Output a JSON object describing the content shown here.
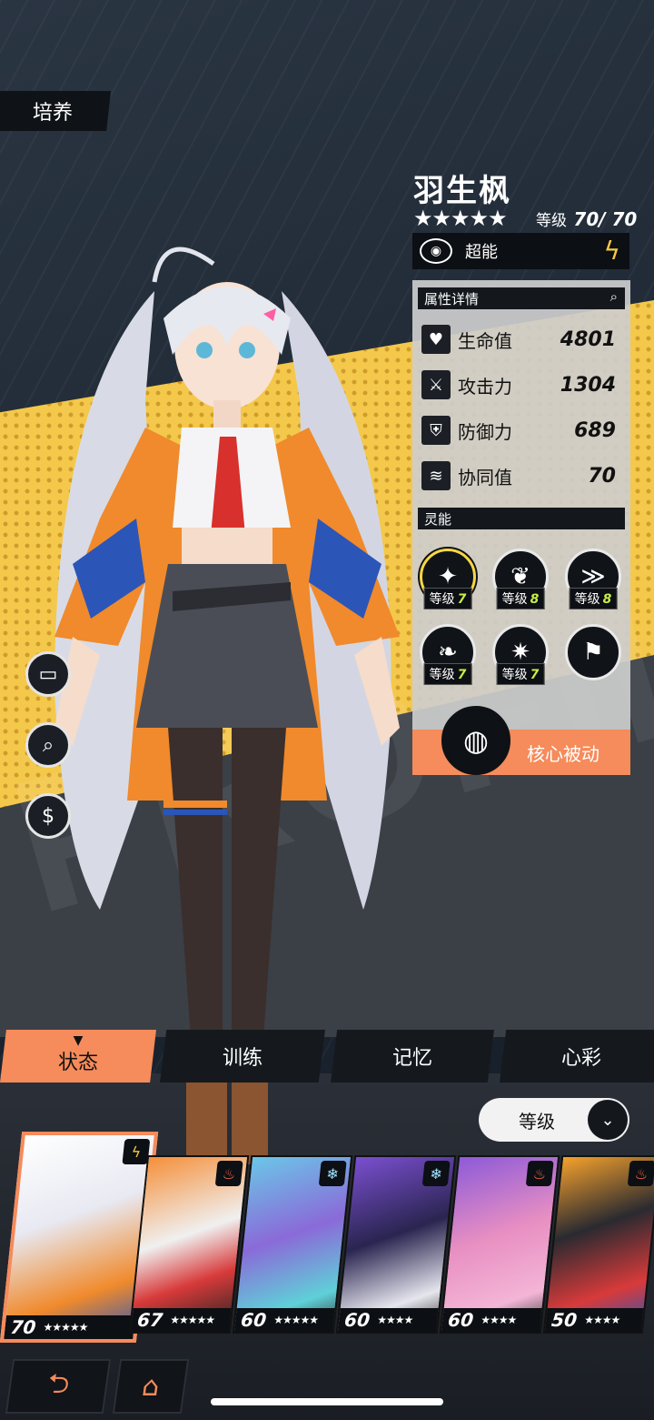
{
  "page": {
    "tag": "培养"
  },
  "character": {
    "name": "羽生枫",
    "stars": "★★★★★",
    "level_label": "等级",
    "level_value": "70/ 70",
    "element_label": "超能"
  },
  "attributes": {
    "title": "属性详情",
    "rows": [
      {
        "label": "生命值",
        "value": "4801",
        "icon": "heart-pulse-icon"
      },
      {
        "label": "攻击力",
        "value": "1304",
        "icon": "sword-icon"
      },
      {
        "label": "防御力",
        "value": "689",
        "icon": "shield-icon"
      },
      {
        "label": "协同值",
        "value": "70",
        "icon": "synergy-icon"
      }
    ]
  },
  "psi": {
    "title": "灵能",
    "skills": [
      {
        "level_label": "等级",
        "level": "7",
        "active": true
      },
      {
        "level_label": "等级",
        "level": "8",
        "active": false
      },
      {
        "level_label": "等级",
        "level": "8",
        "active": false
      },
      {
        "level_label": "等级",
        "level": "7",
        "active": false
      },
      {
        "level_label": "等级",
        "level": "7",
        "active": false
      },
      {
        "level_label": "",
        "level": "",
        "active": false
      }
    ],
    "core_passive": "核心被动"
  },
  "tabs": [
    {
      "label": "状态",
      "active": true
    },
    {
      "label": "训练",
      "active": false
    },
    {
      "label": "记忆",
      "active": false
    },
    {
      "label": "心彩",
      "active": false
    }
  ],
  "sort": {
    "label": "等级"
  },
  "roster": [
    {
      "level": "70",
      "stars": "★★★★★",
      "element": "electric",
      "color": "#f5d9c8"
    },
    {
      "level": "67",
      "stars": "★★★★★",
      "element": "fire",
      "color": "#f58f3a"
    },
    {
      "level": "60",
      "stars": "★★★★★",
      "element": "ice",
      "color": "#6bc6e8"
    },
    {
      "level": "60",
      "stars": "★★★★",
      "element": "ice",
      "color": "#7a4fd0"
    },
    {
      "level": "60",
      "stars": "★★★★",
      "element": "fire",
      "color": "#e88fc2"
    },
    {
      "level": "50",
      "stars": "★★★★",
      "element": "fire",
      "color": "#f5a12c"
    }
  ],
  "colors": {
    "accent": "#f68b5b",
    "yellow": "#f4c84a",
    "level_green": "#c6ee48"
  }
}
